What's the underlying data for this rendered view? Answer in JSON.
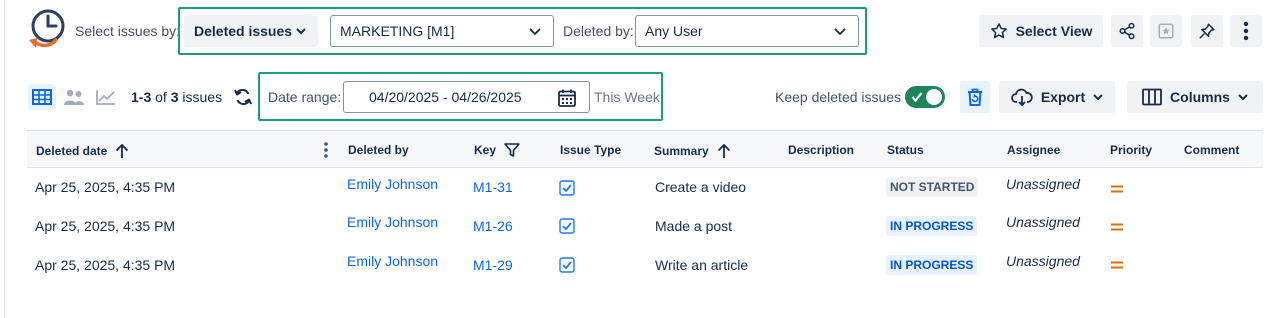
{
  "toolbar": {
    "select_by_label": "Select issues by:",
    "issues_type": "Deleted issues",
    "project": "MARKETING [M1]",
    "deleted_by_label": "Deleted by:",
    "deleted_by_value": "Any User",
    "select_view_label": "Select View"
  },
  "subtoolbar": {
    "count_range": "1-3",
    "count_of": "of",
    "count_total": "3",
    "count_suffix": "issues",
    "date_range_label": "Date range:",
    "date_range_value": "04/20/2025 - 04/26/2025",
    "date_preset": "This Week",
    "keep_deleted_label": "Keep deleted issues",
    "keep_deleted_on": true,
    "export_label": "Export",
    "columns_label": "Columns"
  },
  "table": {
    "columns": [
      "Deleted date",
      "Deleted by",
      "Key",
      "Issue Type",
      "Summary",
      "Description",
      "Status",
      "Assignee",
      "Priority",
      "Comment"
    ],
    "rows": [
      {
        "deleted_date": "Apr 25, 2025, 4:35 PM",
        "deleted_by": "Emily Johnson",
        "key": "M1-31",
        "issue_type": "task-icon",
        "summary": "Create a video",
        "description": "",
        "status": "NOT STARTED",
        "assignee": "Unassigned",
        "priority": "medium-priority-icon",
        "comment": ""
      },
      {
        "deleted_date": "Apr 25, 2025, 4:35 PM",
        "deleted_by": "Emily Johnson",
        "key": "M1-26",
        "issue_type": "task-icon",
        "summary": "Made a post",
        "description": "",
        "status": "IN PROGRESS",
        "assignee": "Unassigned",
        "priority": "medium-priority-icon",
        "comment": ""
      },
      {
        "deleted_date": "Apr 25, 2025, 4:35 PM",
        "deleted_by": "Emily Johnson",
        "key": "M1-29",
        "issue_type": "task-icon",
        "summary": "Write an article",
        "description": "",
        "status": "IN PROGRESS",
        "assignee": "Unassigned",
        "priority": "medium-priority-icon",
        "comment": ""
      }
    ]
  },
  "colors": {
    "highlight": "#1f9d7a",
    "link": "#0c66e4",
    "toggle_on": "#1f845a",
    "logo_orange": "#f26a2e",
    "logo_blue": "#2c3e66",
    "priority_medium": "#e06c00"
  }
}
